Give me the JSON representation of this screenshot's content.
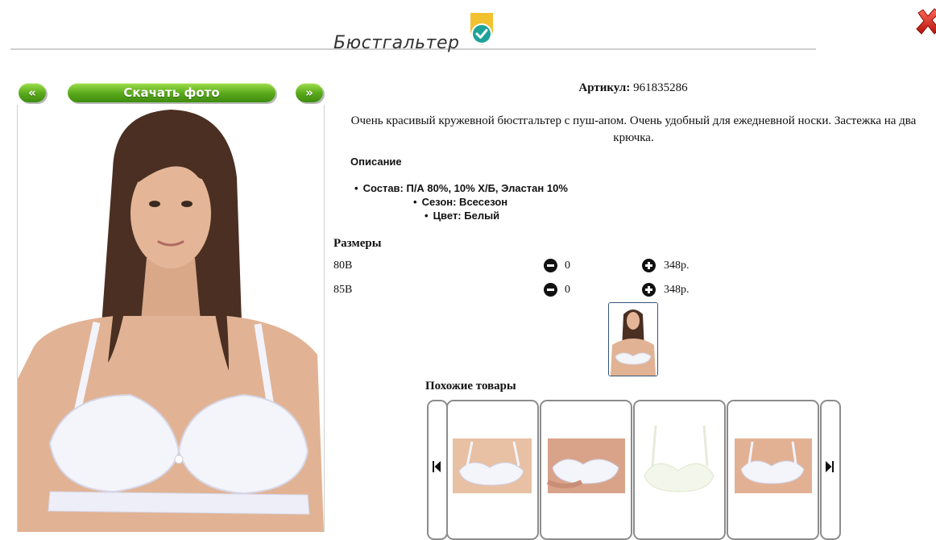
{
  "header": {
    "title": "Бюстгальтер",
    "badge_icon": "verified-shield-check-icon",
    "close_icon": "red-x-close-icon",
    "badge_color": "#f2c12e",
    "check_color": "#1ea39a"
  },
  "gallery": {
    "prev_label": "«",
    "next_label": "»",
    "download_label": "Скачать фото",
    "button_color": "#58a81b"
  },
  "product": {
    "sku_label": "Артикул:",
    "sku_value": "961835286",
    "description": "Очень красивый кружевной бюстгальтер с пуш-апом. Очень удобный для ежедневной носки. Застежка на два крючка.",
    "details_title": "Описание",
    "properties": [
      "Состав: П/А 80%, 10% Х/Б, Эластан 10%",
      "Сезон: Всесезон",
      "Цвет: Белый"
    ]
  },
  "sizes": {
    "title": "Размеры",
    "rows": [
      {
        "size": "80B",
        "qty": "0",
        "price": "348р."
      },
      {
        "size": "85B",
        "qty": "0",
        "price": "348р."
      }
    ]
  },
  "similar": {
    "title": "Похожие товары",
    "items": [
      {
        "icon": "product-photo"
      },
      {
        "icon": "product-photo"
      },
      {
        "icon": "product-photo"
      },
      {
        "icon": "product-photo"
      }
    ]
  }
}
